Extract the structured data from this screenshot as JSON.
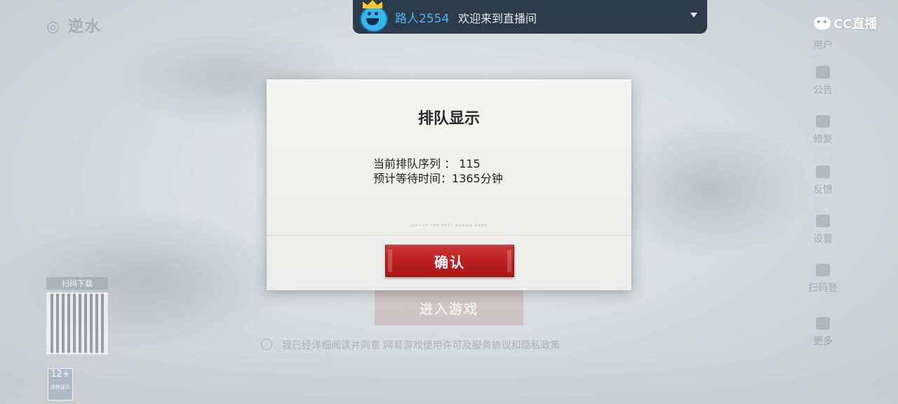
{
  "live_banner": {
    "username": "路人2554",
    "welcome_text": "欢迎来到直播间"
  },
  "brand": {
    "logo_text": "CC直播"
  },
  "dialog": {
    "title": "排队显示",
    "queue_position_label": "当前排队序列 ：",
    "queue_position_value": "115",
    "wait_time_label": "预计等待时间：",
    "wait_time_value": "1365分钟",
    "tiny_caption": "JUSTICE THE BEST MOBILE GAME",
    "confirm_label": "确认"
  },
  "background": {
    "enter_game_label": "进入游戏",
    "agreement_text": "我已经详细阅读并同意 网易游戏使用许可及服务协议和隐私政策",
    "qr_label": "扫码下载",
    "age_rating": "12+",
    "age_rating_sub": "适龄提示",
    "side_menu": [
      "用户",
      "公告",
      "修复",
      "反馈",
      "设置",
      "扫码登",
      "更多"
    ]
  }
}
